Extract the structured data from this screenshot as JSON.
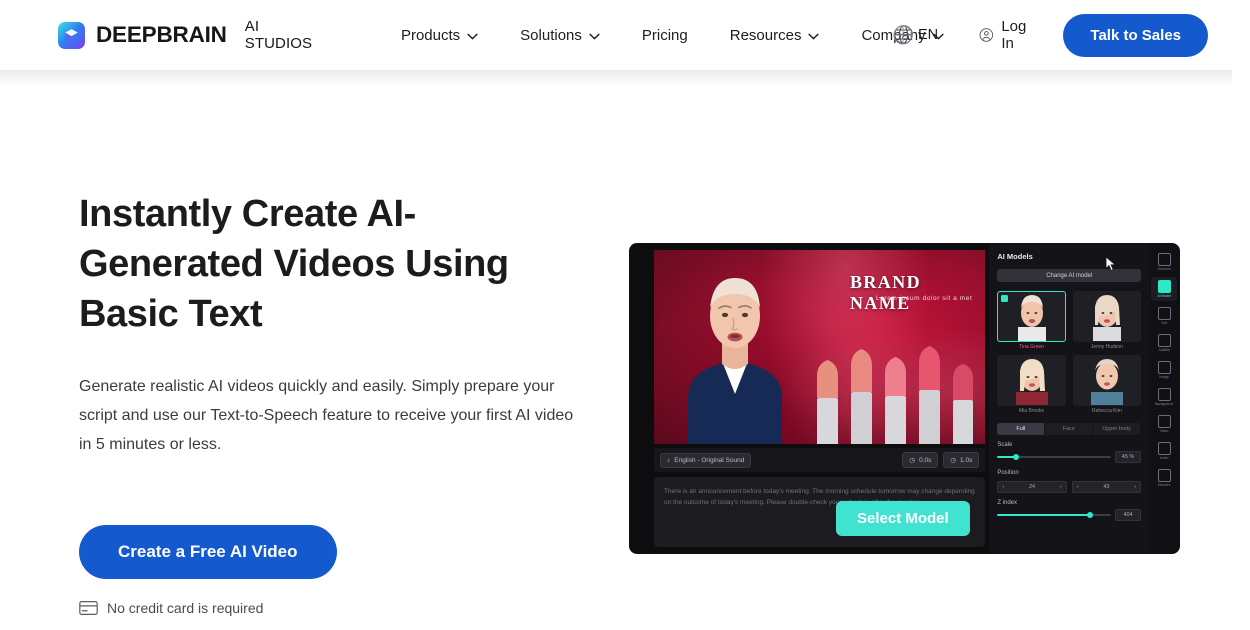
{
  "brand": {
    "name": "DEEPBRAIN",
    "sub": "AI STUDIOS",
    "logo_icon": "cube-logo-icon"
  },
  "colors": {
    "primary_blue": "#1559ce",
    "accent_cyan": "#3fe3d0",
    "text_dark": "#1b1c1e",
    "text_body": "#3a3c40",
    "header_bg": "#ffffff",
    "editor_bg": "#0d0d10"
  },
  "nav": {
    "items": [
      {
        "label": "Products",
        "has_caret": true
      },
      {
        "label": "Solutions",
        "has_caret": true
      },
      {
        "label": "Pricing",
        "has_caret": false
      },
      {
        "label": "Resources",
        "has_caret": true
      },
      {
        "label": "Company",
        "has_caret": true
      }
    ],
    "language": {
      "label": "EN",
      "icon": "globe-icon"
    },
    "login": {
      "label": "Log In",
      "icon": "user-circle-icon"
    },
    "cta": {
      "label": "Talk to Sales"
    }
  },
  "hero": {
    "title": "Instantly Create AI-Generated Videos Using Basic Text",
    "subtitle": "Generate realistic AI videos quickly and easily. Simply prepare your script and use our Text-to-Speech feature to receive your first AI video in 5 minutes or less.",
    "cta_label": "Create a Free AI Video",
    "note": "No credit card is required",
    "note_icon": "credit-card-icon"
  },
  "editor": {
    "stage": {
      "brand_name": "BRAND NAME",
      "brand_tagline": "Lorem ipsum dolor sit a met"
    },
    "video_bar": {
      "voice_chip": "English - Original Sound",
      "duration_chip": "0.0s",
      "total_chip": "1.0s"
    },
    "script_text": "There is an announcement before today's meeting. The morning schedule tomorrow may change depending on the outcome of today's meeting. Please double-check your schedule after the meeting.",
    "panel": {
      "title": "AI Models",
      "change_button": "Change AI model",
      "models": [
        {
          "name": "Tina Green",
          "selected": true
        },
        {
          "name": "Jenny Hudson",
          "selected": false
        },
        {
          "name": "Mia Brooks",
          "selected": false
        },
        {
          "name": "Rebecca Kim",
          "selected": false
        }
      ],
      "view_tabs": [
        {
          "label": "Full",
          "active": true
        },
        {
          "label": "Face",
          "active": false
        },
        {
          "label": "Upper body",
          "active": false
        }
      ],
      "controls": [
        {
          "label": "Scale",
          "value": "45 %",
          "fill_pct": 16
        },
        {
          "label": "Z index",
          "value": "404",
          "fill_pct": 82
        }
      ],
      "position": {
        "label": "Position",
        "x_value": "24",
        "y_value": "43"
      }
    },
    "rail_items": [
      {
        "label": "Scenario",
        "icon": "scenario-icon",
        "active": false
      },
      {
        "label": "AI Model",
        "icon": "ai-model-icon",
        "active": true
      },
      {
        "label": "Text",
        "icon": "text-icon",
        "active": false
      },
      {
        "label": "Subtitle",
        "icon": "subtitle-icon",
        "active": false
      },
      {
        "label": "Image",
        "icon": "image-icon",
        "active": false
      },
      {
        "label": "Background",
        "icon": "background-icon",
        "active": false
      },
      {
        "label": "Video",
        "icon": "video-icon",
        "active": false
      },
      {
        "label": "Audio",
        "icon": "audio-icon",
        "active": false
      },
      {
        "label": "Element",
        "icon": "element-icon",
        "active": false
      }
    ],
    "select_model_button": "Select Model"
  }
}
